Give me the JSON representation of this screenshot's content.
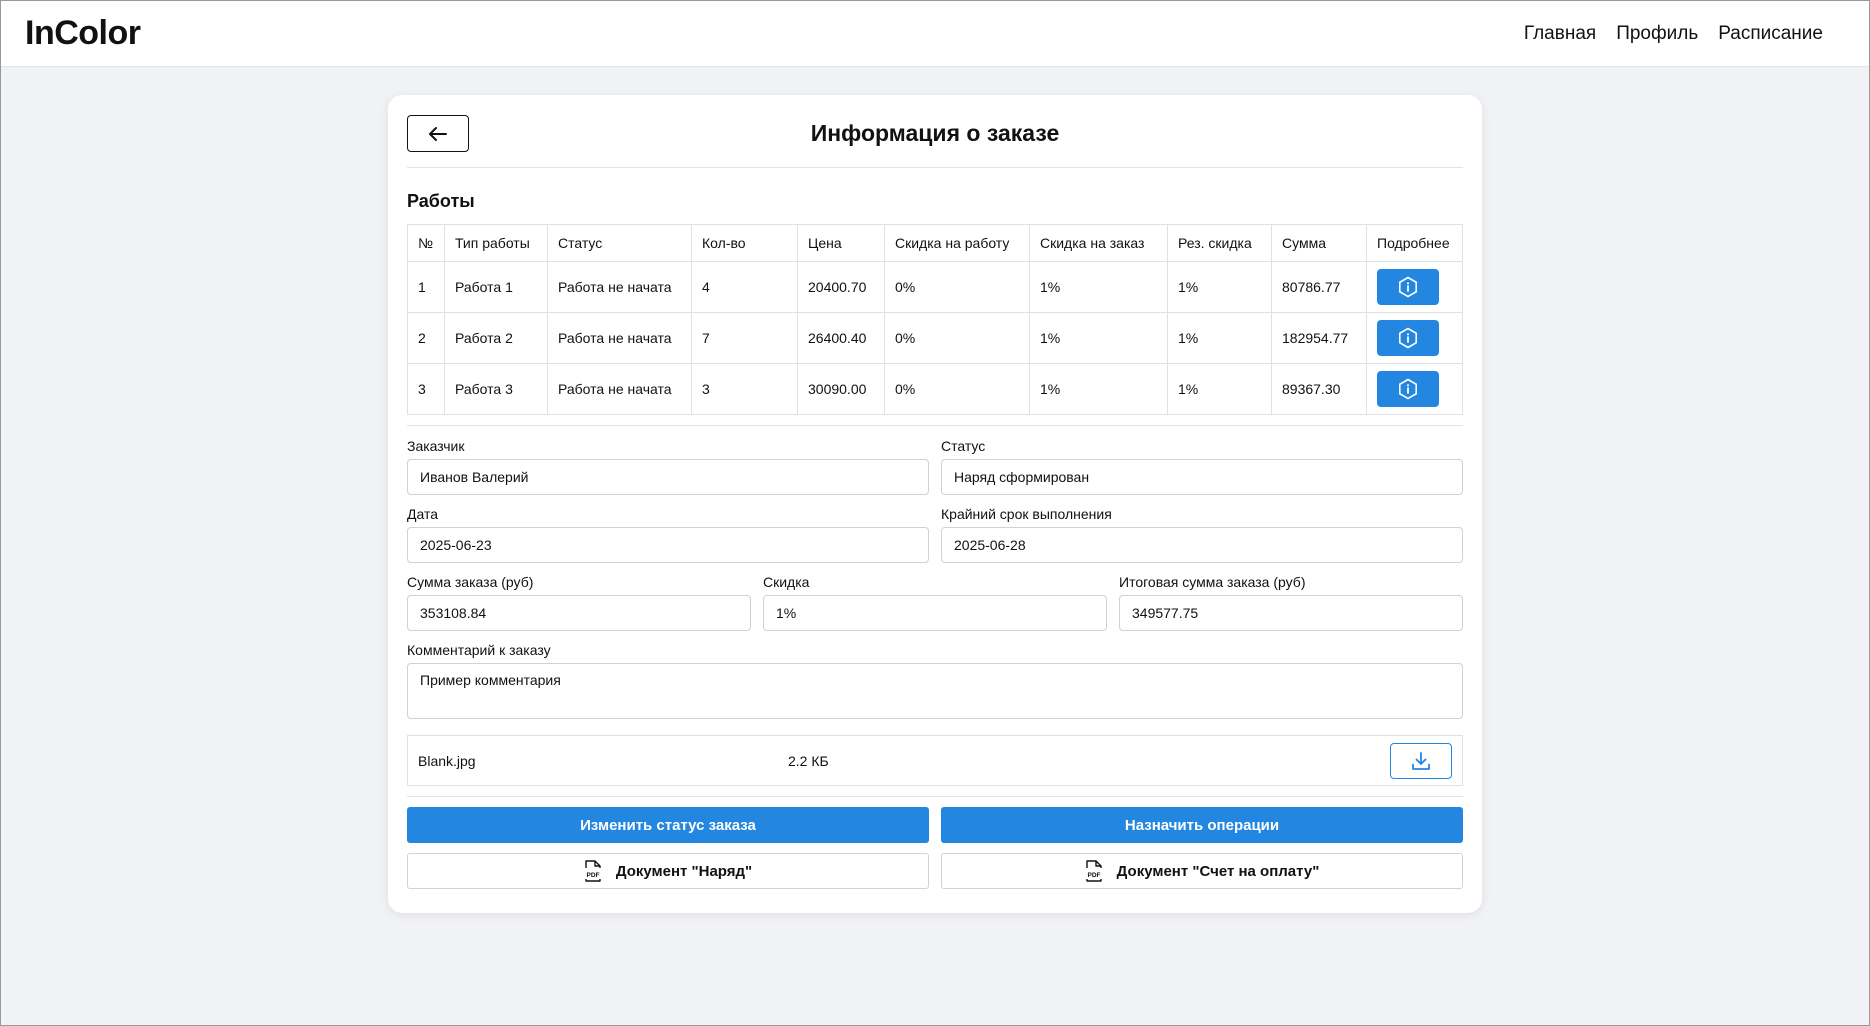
{
  "header": {
    "brand": "InColor",
    "nav": [
      {
        "label": "Главная"
      },
      {
        "label": "Профиль"
      },
      {
        "label": "Расписание"
      }
    ]
  },
  "card": {
    "title": "Информация о заказе",
    "works_title": "Работы"
  },
  "table": {
    "headers": [
      "№",
      "Тип работы",
      "Статус",
      "Кол-во",
      "Цена",
      "Скидка на работу",
      "Скидка на заказ",
      "Рез. скидка",
      "Сумма",
      "Подробнее"
    ],
    "rows": [
      {
        "num": "1",
        "type": "Работа 1",
        "status": "Работа не начата",
        "qty": "4",
        "price": "20400.70",
        "work_discount": "0%",
        "order_discount": "1%",
        "res_discount": "1%",
        "sum": "80786.77"
      },
      {
        "num": "2",
        "type": "Работа 2",
        "status": "Работа не начата",
        "qty": "7",
        "price": "26400.40",
        "work_discount": "0%",
        "order_discount": "1%",
        "res_discount": "1%",
        "sum": "182954.77"
      },
      {
        "num": "3",
        "type": "Работа 3",
        "status": "Работа не начата",
        "qty": "3",
        "price": "30090.00",
        "work_discount": "0%",
        "order_discount": "1%",
        "res_discount": "1%",
        "sum": "89367.30"
      }
    ]
  },
  "form": {
    "customer_label": "Заказчик",
    "customer_value": "Иванов Валерий",
    "status_label": "Статус",
    "status_value": "Наряд сформирован",
    "date_label": "Дата",
    "date_value": "2025-06-23",
    "deadline_label": "Крайний срок выполнения",
    "deadline_value": "2025-06-28",
    "sum_label": "Сумма заказа (руб)",
    "sum_value": "353108.84",
    "discount_label": "Скидка",
    "discount_value": "1%",
    "total_label": "Итоговая сумма заказа (руб)",
    "total_value": "349577.75",
    "comment_label": "Комментарий к заказу",
    "comment_value": "Пример комментария"
  },
  "file": {
    "name": "Blank.jpg",
    "size": "2.2 КБ"
  },
  "actions": {
    "change_status": "Изменить статус заказа",
    "assign_ops": "Назначить операции",
    "doc_order": "Документ \"Наряд\"",
    "doc_invoice": "Документ \"Счет на оплату\""
  },
  "colors": {
    "accent": "#2386e0",
    "background": "#f1f2f5"
  }
}
